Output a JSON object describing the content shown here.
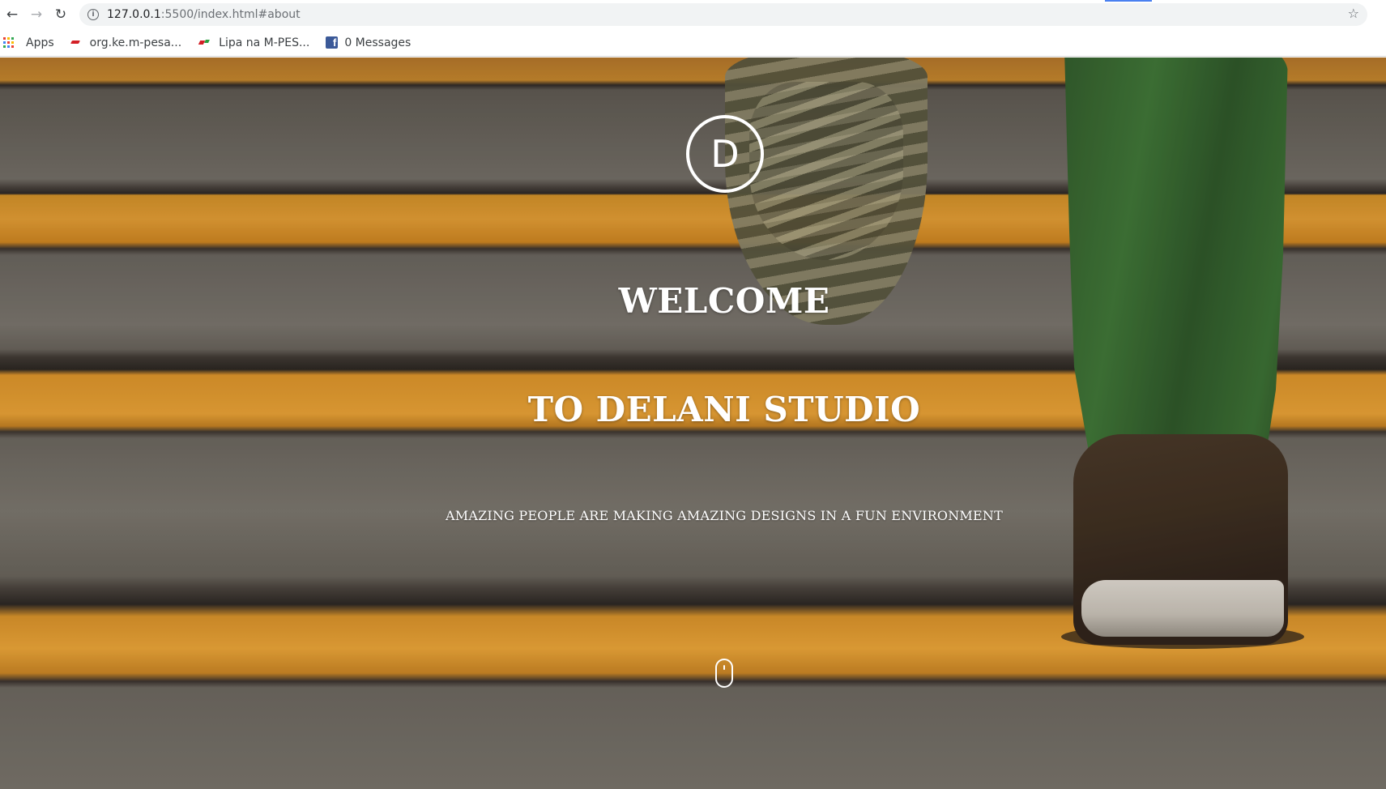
{
  "browser": {
    "url_host": "127.0.0.1",
    "url_rest": ":5500/index.html#about",
    "back_icon": "arrow-left-icon",
    "forward_icon": "arrow-right-icon",
    "reload_icon": "reload-icon",
    "bookmarks": [
      {
        "label": "Apps",
        "icon": "apps-grid-icon"
      },
      {
        "label": "org.ke.m-pesa...",
        "icon": "mpesa-icon"
      },
      {
        "label": "Lipa na M-PES...",
        "icon": "mpesa-icon"
      },
      {
        "label": "0 Messages",
        "icon": "facebook-icon"
      }
    ]
  },
  "hero": {
    "logo_letter": "D",
    "title_line_1": "WELCOME",
    "title_line_2": "TO DELANI STUDIO",
    "tagline": "AMAZING PEOPLE ARE MAKING AMAZING DESIGNS IN A FUN ENVIRONMENT"
  },
  "colors": {
    "text": "#ffffff",
    "stripe_orange": "#f0a838",
    "step_grey": "#74716a"
  }
}
